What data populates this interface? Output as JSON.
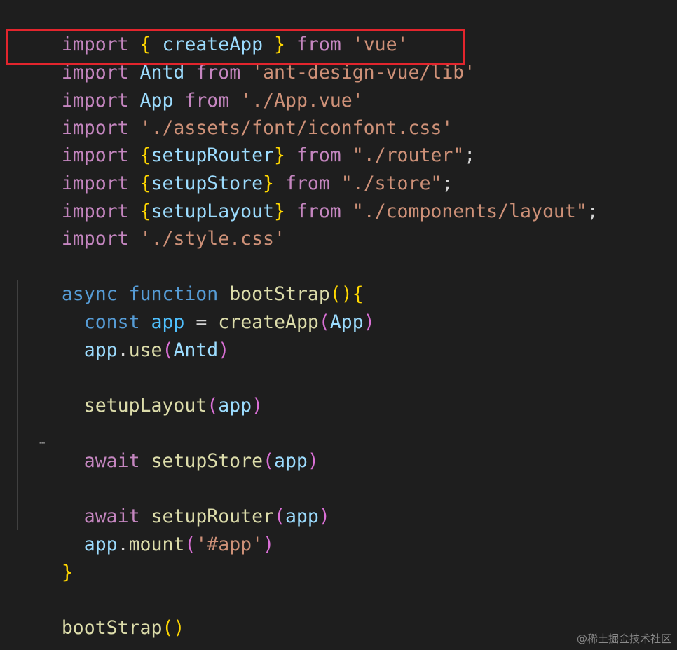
{
  "code_lines": {
    "l1": [
      "import",
      " ",
      "{",
      " ",
      "createApp",
      " ",
      "}",
      " ",
      "from",
      " ",
      "'vue'"
    ],
    "l2": [
      "import",
      " ",
      "Antd",
      " ",
      "from",
      " ",
      "'ant-design-vue/lib'"
    ],
    "l3": [
      "import",
      " ",
      "App",
      " ",
      "from",
      " ",
      "'./App.vue'"
    ],
    "l4": [
      "import",
      " ",
      "'./assets/font/iconfont.css'"
    ],
    "l5": [
      "import",
      " ",
      "{",
      "setupRouter",
      "}",
      " ",
      "from",
      " ",
      "\"./router\"",
      ";"
    ],
    "l6": [
      "import",
      " ",
      "{",
      "setupStore",
      "}",
      " ",
      "from",
      " ",
      "\"./store\"",
      ";"
    ],
    "l7": [
      "import",
      " ",
      "{",
      "setupLayout",
      "}",
      " ",
      "from",
      " ",
      "\"./components/layout\"",
      ";"
    ],
    "l8": [
      "import",
      " ",
      "'./style.css'"
    ],
    "l10": [
      "async",
      " ",
      "function",
      " ",
      "bootStrap",
      "(",
      ")",
      "{"
    ],
    "l11": [
      "  ",
      "const",
      " ",
      "app",
      " ",
      "=",
      " ",
      "createApp",
      "(",
      "App",
      ")"
    ],
    "l12": [
      "  ",
      "app",
      ".",
      "use",
      "(",
      "Antd",
      ")"
    ],
    "l14": [
      "  ",
      "setupLayout",
      "(",
      "app",
      ")"
    ],
    "l16": [
      "  ",
      "await",
      " ",
      "setupStore",
      "(",
      "app",
      ")"
    ],
    "l18": [
      "  ",
      "await",
      " ",
      "setupRouter",
      "(",
      "app",
      ")"
    ],
    "l19": [
      "  ",
      "app",
      ".",
      "mount",
      "(",
      "'#app'",
      ")"
    ],
    "l20": [
      "}"
    ],
    "l22": [
      "bootStrap",
      "(",
      ")"
    ]
  },
  "squiggle_glyph": "⋯",
  "watermark": "@稀土掘金技术社区",
  "colors": {
    "background": "#1e1e1e",
    "keyword_control": "#c586c0",
    "keyword_storage": "#569cd6",
    "variable": "#9cdcfe",
    "function": "#dcdcaa",
    "string": "#ce9178",
    "bracket_level1": "#ffd700",
    "bracket_level2": "#da70d6",
    "highlight_border": "#e3252d"
  }
}
